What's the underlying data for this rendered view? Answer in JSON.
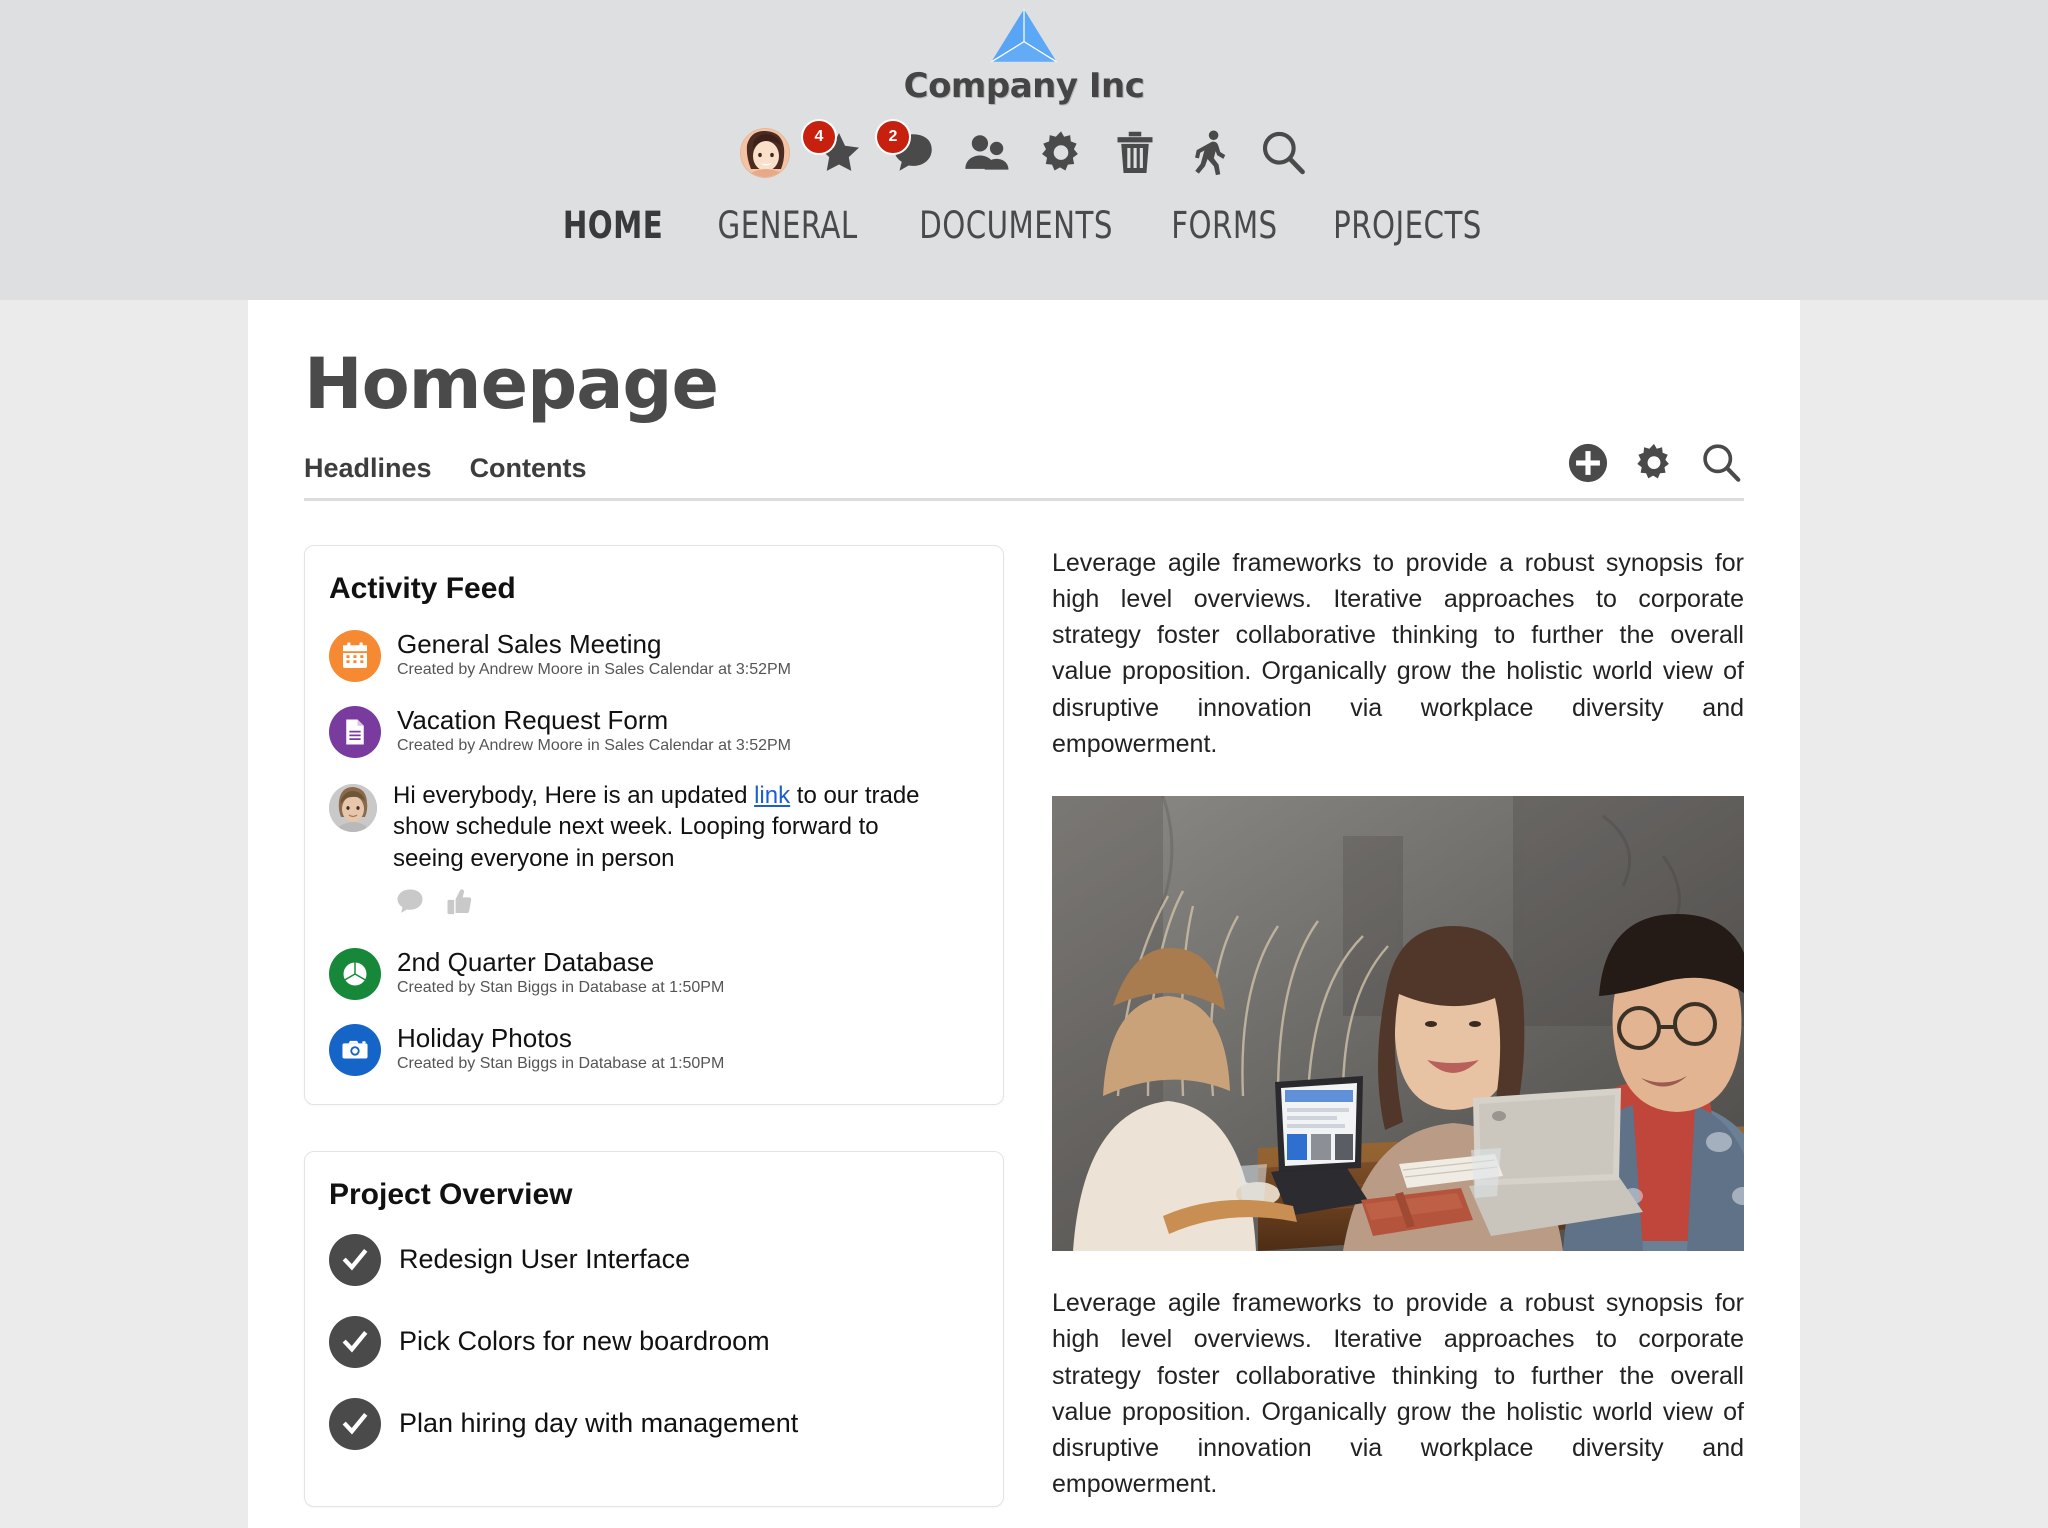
{
  "header": {
    "brand_name": "Company Inc",
    "logo_icon": "pyramid-logo",
    "icons": [
      {
        "name": "user-avatar",
        "label": "Profile"
      },
      {
        "name": "star-icon",
        "label": "Favorites",
        "badge": "4"
      },
      {
        "name": "chat-bubble-icon",
        "label": "Messages",
        "badge": "2"
      },
      {
        "name": "people-icon",
        "label": "People"
      },
      {
        "name": "gear-icon",
        "label": "Settings"
      },
      {
        "name": "trash-icon",
        "label": "Trash"
      },
      {
        "name": "walking-person-icon",
        "label": "Activity"
      },
      {
        "name": "search-icon",
        "label": "Search"
      }
    ],
    "nav": [
      {
        "label": "HOME",
        "active": true
      },
      {
        "label": "GENERAL",
        "active": false
      },
      {
        "label": "DOCUMENTS",
        "active": false
      },
      {
        "label": "FORMS",
        "active": false
      },
      {
        "label": "PROJECTS",
        "active": false
      }
    ]
  },
  "page": {
    "title": "Homepage",
    "tabs": [
      {
        "label": "Headlines"
      },
      {
        "label": "Contents"
      }
    ],
    "tools": [
      {
        "name": "add-button",
        "label": "Add"
      },
      {
        "name": "settings-button",
        "label": "Settings"
      },
      {
        "name": "search-button",
        "label": "Search"
      }
    ]
  },
  "activity_feed": {
    "title": "Activity Feed",
    "items": [
      {
        "type": "event",
        "icon": "calendar-icon",
        "icon_color": "#f58a33",
        "title": "General Sales Meeting",
        "meta": "Created by Andrew Moore in Sales Calendar at 3:52PM"
      },
      {
        "type": "event",
        "icon": "document-icon",
        "icon_color": "#7a3b9e",
        "title": "Vacation Request Form",
        "meta": "Created by Andrew Moore in Sales Calendar at 3:52PM"
      },
      {
        "type": "post",
        "icon": "user-avatar",
        "text_before": "Hi everybody,  Here is an updated ",
        "link_text": "link",
        "text_after": " to our trade show schedule next week. Looping forward to seeing everyone in person",
        "actions": [
          {
            "name": "comment-icon",
            "label": "Comment"
          },
          {
            "name": "thumbs-up-icon",
            "label": "Like"
          }
        ]
      },
      {
        "type": "event",
        "icon": "pie-chart-icon",
        "icon_color": "#17883a",
        "title": "2nd Quarter Database",
        "meta": "Created by Stan Biggs in Database at 1:50PM"
      },
      {
        "type": "event",
        "icon": "camera-icon",
        "icon_color": "#1565c8",
        "title": "Holiday Photos",
        "meta": "Created by Stan Biggs in Database at 1:50PM"
      }
    ]
  },
  "project_overview": {
    "title": "Project Overview",
    "items": [
      {
        "icon": "check-icon",
        "label": "Redesign User Interface",
        "checked": true
      },
      {
        "icon": "check-icon",
        "label": "Pick Colors for new boardroom",
        "checked": true
      },
      {
        "icon": "check-icon",
        "label": "Plan hiring day with management",
        "checked": true
      }
    ]
  },
  "main_content": {
    "paragraph_top": "Leverage agile frameworks to provide a robust synopsis for high level overviews. Iterative approaches to corporate strategy foster collaborative thinking to further the overall value proposition. Organically grow the holistic world view of disruptive innovation via workplace diversity and empowerment.",
    "image": {
      "name": "team-meeting-photo",
      "alt": "Three colleagues laughing around a wooden table with laptops in front of a gray concrete wall"
    },
    "paragraph_bottom": "Leverage agile frameworks to provide a robust synopsis for high level overviews. Iterative approaches to corporate strategy foster collaborative thinking to further the overall value proposition. Organically grow the holistic world view of disruptive innovation via workplace diversity and empowerment."
  },
  "colors": {
    "header_bg": "#dedfe0",
    "page_bg": "#ebebeb",
    "sheet_bg": "#ffffff",
    "logo_blue": "#59a5f5",
    "badge_red": "#c8200f",
    "text_dark": "#4a4a4a",
    "link_blue": "#1a5fd0"
  }
}
